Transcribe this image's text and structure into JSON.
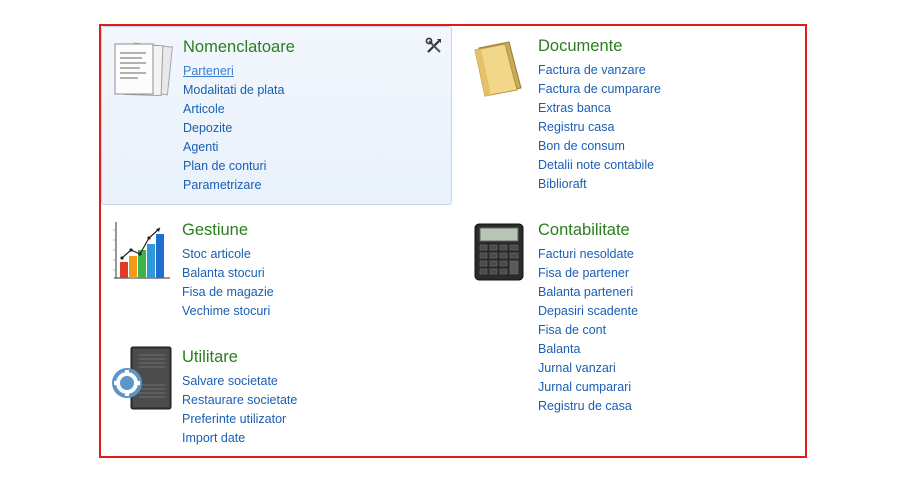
{
  "sections": {
    "nomenclatoare": {
      "title": "Nomenclatoare",
      "icon": "documents-stack-icon",
      "items": [
        "Parteneri",
        "Modalitati de plata",
        "Articole",
        "Depozite",
        "Agenti",
        "Plan de conturi",
        "Parametrizare"
      ]
    },
    "documente": {
      "title": "Documente",
      "icon": "folder-icon",
      "items": [
        "Factura de vanzare",
        "Factura de cumparare",
        "Extras banca",
        "Registru casa",
        "Bon de consum",
        "Detalii note contabile",
        "Biblioraft"
      ]
    },
    "gestiune": {
      "title": "Gestiune",
      "icon": "bar-chart-icon",
      "items": [
        "Stoc articole",
        "Balanta stocuri",
        "Fisa de magazie",
        "Vechime stocuri"
      ]
    },
    "contabilitate": {
      "title": "Contabilitate",
      "icon": "calculator-icon",
      "items": [
        "Facturi nesoldate",
        "Fisa de partener",
        "Balanta parteneri",
        "Depasiri scadente",
        "Fisa de cont",
        "Balanta",
        "Jurnal vanzari",
        "Jurnal cumparari",
        "Registru de casa"
      ]
    },
    "utilitare": {
      "title": "Utilitare",
      "icon": "server-gear-icon",
      "items": [
        "Salvare societate",
        "Restaurare societate",
        "Preferinte utilizator",
        "Import date"
      ]
    }
  },
  "colors": {
    "frame_border": "#e01b1b",
    "title_green": "#2b7d1f",
    "link_blue": "#1a5fb4",
    "active_panel_bg": "#eef4fc"
  },
  "tools_icon": "wrench-screwdriver-icon"
}
